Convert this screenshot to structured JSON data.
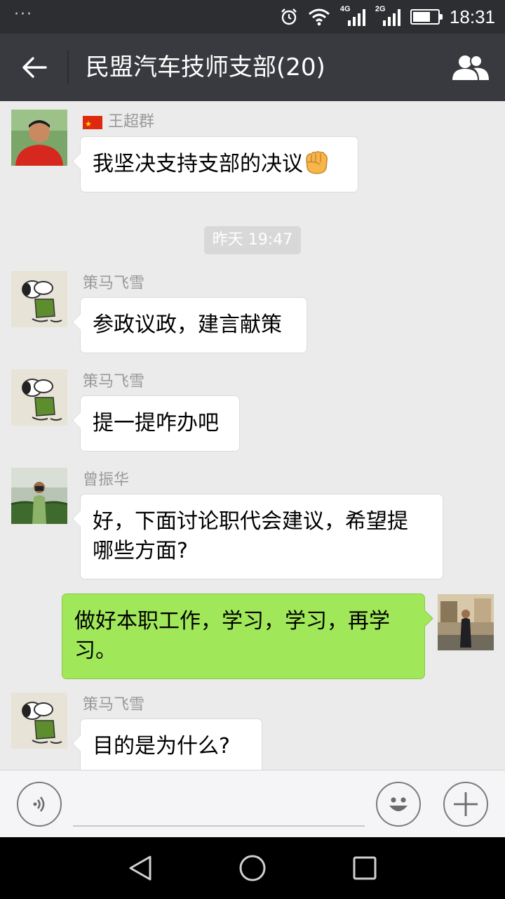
{
  "status_bar": {
    "time": "18:31",
    "net1": "4G",
    "net2": "2G",
    "battery_level": 0.72
  },
  "header": {
    "title": "民盟汽车技师支部(20)"
  },
  "messages": [
    {
      "sender": "王超群",
      "text": "我坚决支持支部的决议",
      "emoji": "fist-emoji",
      "flag": "china-flag"
    },
    {
      "timestamp": "昨天 19:47"
    },
    {
      "sender": "策马飞雪",
      "text": "参政议政，建言献策"
    },
    {
      "sender": "策马飞雪",
      "text": "提一提咋办吧"
    },
    {
      "sender": "曾振华",
      "text_line1": "好，下面讨论职代会建议，希望提",
      "text_line2": "哪些方面?"
    },
    {
      "sender": "me",
      "text_line1": "做好本职工作，学习，学习，再学",
      "text_line2": "习。"
    },
    {
      "sender": "策马飞雪",
      "text": "目的是为什么?"
    }
  ],
  "input_bar": {
    "voice_icon": "voice-icon",
    "emoji_icon": "smiley-icon",
    "more_icon": "plus-icon"
  },
  "colors": {
    "title_bar": "#393a3f",
    "status_bar": "#2d2e31",
    "chat_bg": "#ebebeb",
    "my_bubble": "#a0e75a",
    "other_bubble": "#ffffff"
  }
}
